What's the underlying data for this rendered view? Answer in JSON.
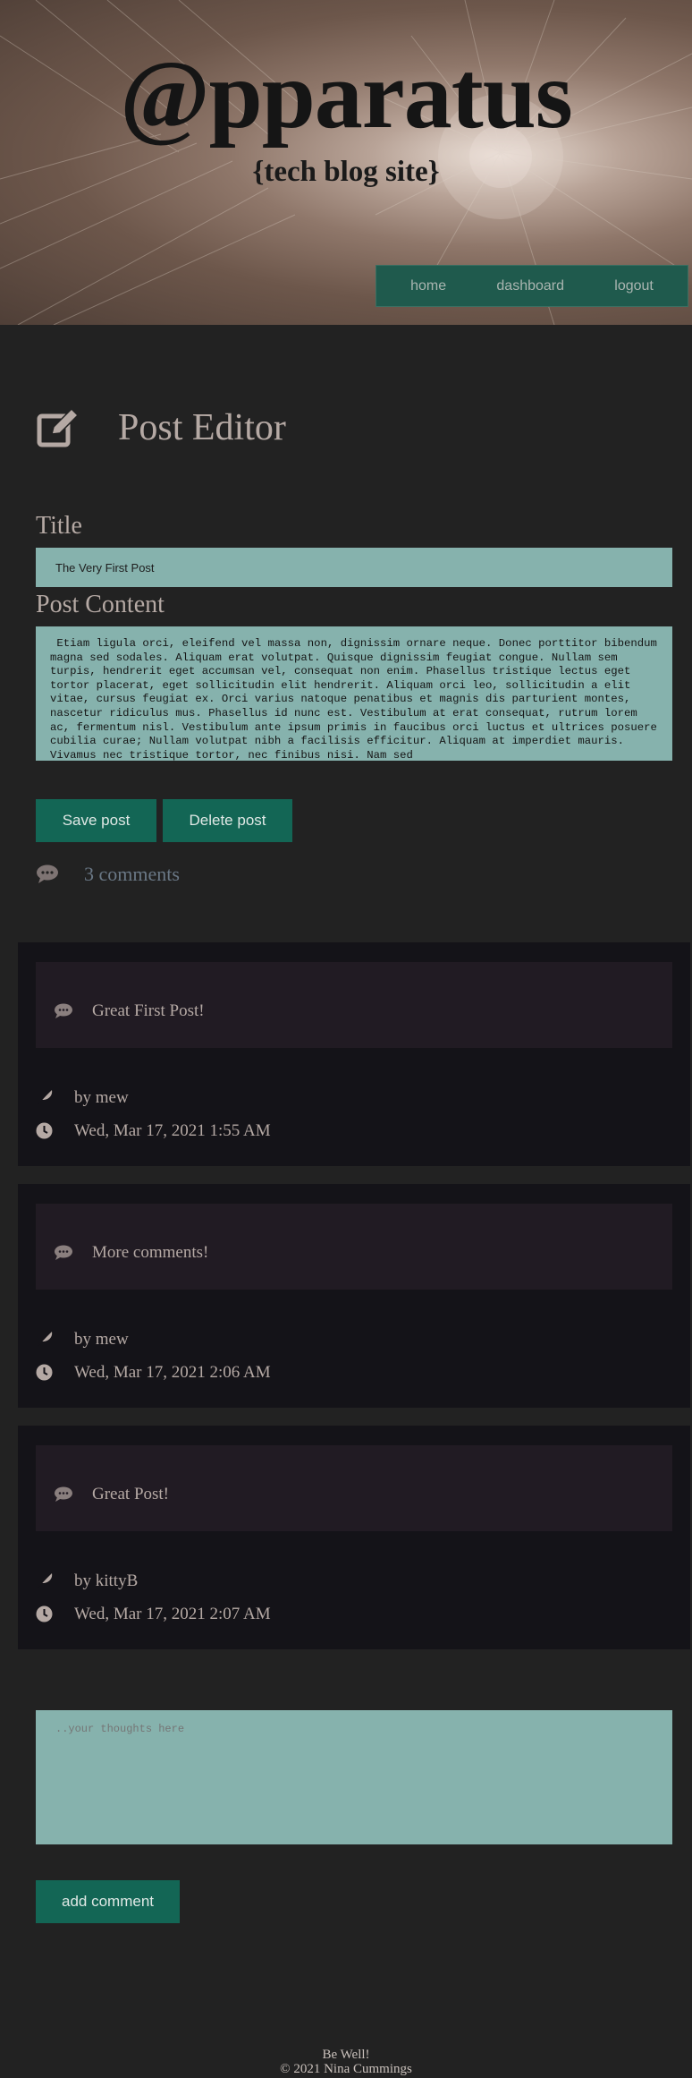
{
  "header": {
    "brand": "@pparatus",
    "tagline": "{tech blog site}",
    "nav": [
      "home",
      "dashboard",
      "logout"
    ]
  },
  "editor": {
    "heading": "Post Editor",
    "title_label": "Title",
    "title_value": "The Very First Post",
    "content_label": "Post Content",
    "content_value": " Etiam ligula orci, eleifend vel massa non, dignissim ornare neque. Donec porttitor bibendum magna sed sodales. Aliquam erat volutpat. Quisque dignissim feugiat congue. Nullam sem turpis, hendrerit eget accumsan vel, consequat non enim. Phasellus tristique lectus eget tortor placerat, eget sollicitudin elit hendrerit. Aliquam orci leo, sollicitudin a elit vitae, cursus feugiat ex. Orci varius natoque penatibus et magnis dis parturient montes, nascetur ridiculus mus. Phasellus id nunc est. Vestibulum at erat consequat, rutrum lorem ac, fermentum nisl. Vestibulum ante ipsum primis in faucibus orci luctus et ultrices posuere cubilia curae; Nullam volutpat nibh a facilisis efficitur. Aliquam at imperdiet mauris. Vivamus nec tristique tortor, nec finibus nisi. Nam sed",
    "save_label": "Save post",
    "delete_label": "Delete post",
    "comment_count": "3 comments"
  },
  "comments": [
    {
      "text": "Great First Post!",
      "author": "by mew",
      "time": "Wed, Mar 17, 2021 1:55 AM"
    },
    {
      "text": "More comments!",
      "author": "by mew",
      "time": "Wed, Mar 17, 2021 2:06 AM"
    },
    {
      "text": "Great Post!",
      "author": "by kittyB",
      "time": "Wed, Mar 17, 2021 2:07 AM"
    }
  ],
  "new_comment": {
    "placeholder": "..your thoughts here",
    "button_label": "add comment"
  },
  "footer": {
    "line1": "Be Well!",
    "line2": "© 2021 Nina Cummings"
  },
  "colors": {
    "background": "#222222",
    "accent": "#136655",
    "input": "#86b2ad",
    "card": "#141318"
  },
  "icons": [
    "edit-icon",
    "comments-icon",
    "comment-icon",
    "feather-icon",
    "clock-icon"
  ]
}
